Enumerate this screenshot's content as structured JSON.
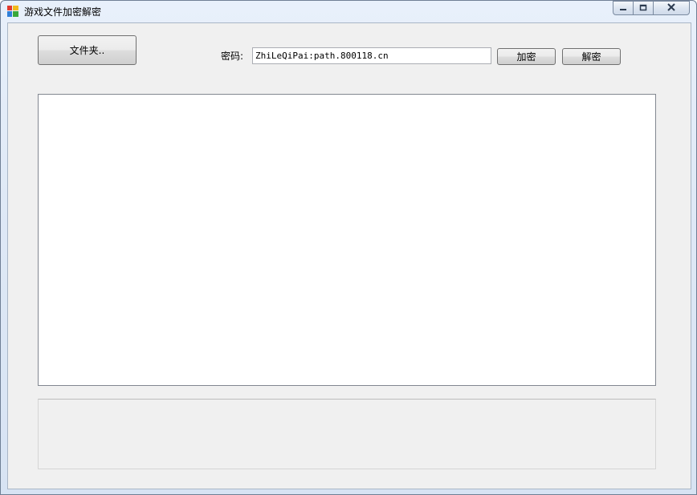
{
  "window": {
    "title": "游戏文件加密解密",
    "icon": "app-window-icon"
  },
  "caption": {
    "minimize_icon": "minimize-icon",
    "maximize_icon": "maximize-icon",
    "close_icon": "close-icon"
  },
  "toolbar": {
    "folder_button_label": "文件夹..",
    "password_label": "密码:",
    "password_value": "ZhiLeQiPai:path.800118.cn",
    "encrypt_button_label": "加密",
    "decrypt_button_label": "解密"
  },
  "file_list": {
    "items": []
  },
  "status": {
    "text": ""
  },
  "colors": {
    "client_background": "#f0f0f0",
    "list_background": "#ffffff"
  }
}
